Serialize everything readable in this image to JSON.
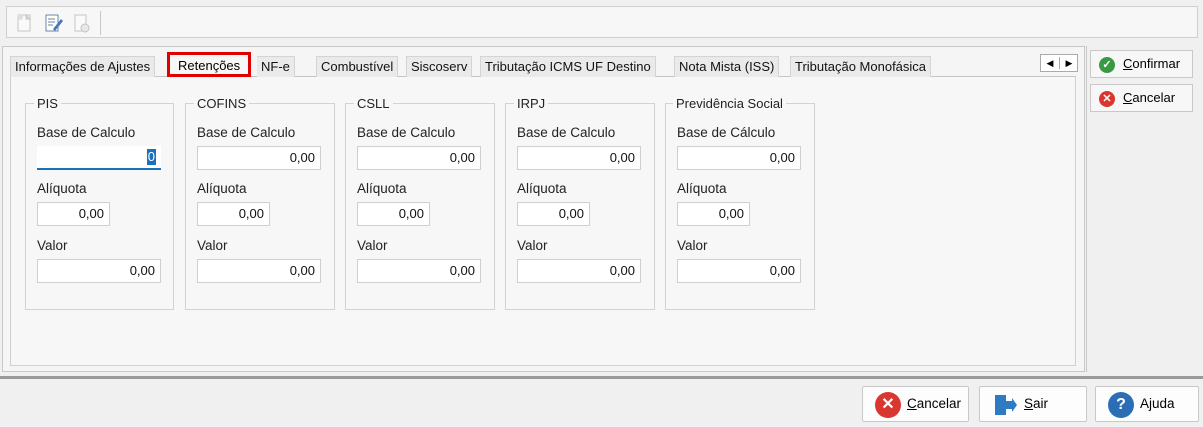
{
  "tabs": [
    "Informações de Ajustes",
    "Retenções",
    "NF-e",
    "Combustível",
    "Siscoserv",
    "Tributação ICMS UF Destino",
    "Nota Mista (ISS)",
    "Tributação Monofásica"
  ],
  "groups": [
    {
      "title": "PIS",
      "base_label": "Base de Calculo",
      "base_value": "0",
      "aliquota_label": "Alíquota",
      "aliquota_value": "0,00",
      "valor_label": "Valor",
      "valor_value": "0,00"
    },
    {
      "title": "COFINS",
      "base_label": "Base de Calculo",
      "base_value": "0,00",
      "aliquota_label": "Alíquota",
      "aliquota_value": "0,00",
      "valor_label": "Valor",
      "valor_value": "0,00"
    },
    {
      "title": "CSLL",
      "base_label": "Base de Calculo",
      "base_value": "0,00",
      "aliquota_label": "Alíquota",
      "aliquota_value": "0,00",
      "valor_label": "Valor",
      "valor_value": "0,00"
    },
    {
      "title": "IRPJ",
      "base_label": "Base de Calculo",
      "base_value": "0,00",
      "aliquota_label": "Alíquota",
      "aliquota_value": "0,00",
      "valor_label": "Valor",
      "valor_value": "0,00"
    },
    {
      "title": "Previdência Social",
      "base_label": "Base de Cálculo",
      "base_value": "0,00",
      "aliquota_label": "Alíquota",
      "aliquota_value": "0,00",
      "valor_label": "Valor",
      "valor_value": "0,00"
    }
  ],
  "side": {
    "confirm_first": "C",
    "confirm_rest": "onfirmar",
    "cancel_first": "C",
    "cancel_rest": "ancelar"
  },
  "bottom": {
    "cancel_first": "C",
    "cancel_rest": "ancelar",
    "exit_first": "S",
    "exit_rest": "air",
    "help_first": "A",
    "help_mid": "j",
    "help_rest": "uda"
  },
  "colors": {
    "confirm": "#3a9a43",
    "cancel": "#d9362f",
    "help": "#2c6eb5",
    "exit": "#2c7bc4",
    "highlight": "#e00000"
  },
  "icons": {
    "toolbar": [
      "new-doc-icon",
      "edit-doc-icon",
      "delete-doc-icon"
    ],
    "confirm": "check-circle-icon",
    "cancel": "x-circle-icon",
    "exit": "exit-door-icon",
    "help": "question-circle-icon"
  }
}
